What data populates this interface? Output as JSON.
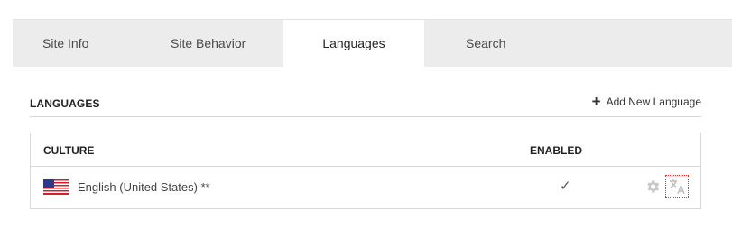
{
  "tabs": [
    {
      "label": "Site Info",
      "active": false
    },
    {
      "label": "Site Behavior",
      "active": false
    },
    {
      "label": "Languages",
      "active": true
    },
    {
      "label": "Search",
      "active": false
    }
  ],
  "section": {
    "title": "LANGUAGES",
    "add_label": "Add New Language",
    "add_icon": "plus-icon"
  },
  "table": {
    "headers": {
      "culture": "CULTURE",
      "enabled": "ENABLED"
    },
    "rows": [
      {
        "flag": "us-flag-icon",
        "culture": "English (United States) **",
        "enabled_icon": "checkmark-icon",
        "actions": [
          "gear-icon",
          "translate-icon"
        ]
      }
    ]
  },
  "colors": {
    "tabbar_bg": "#ececec",
    "active_tab_bg": "#ffffff",
    "focus_outline": "#dd3333",
    "icon_gray": "#c8c8c8"
  }
}
